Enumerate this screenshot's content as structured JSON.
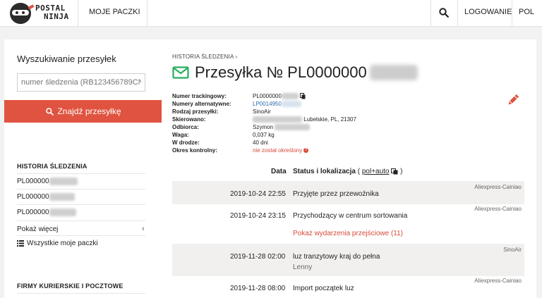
{
  "header": {
    "logo_line1": "POSTAL",
    "logo_line2": "NINJA",
    "nav_my_packages": "MOJE PACZKI",
    "nav_login": "LOGOWANIE",
    "nav_language": "POL",
    "icons": {
      "search": "search-icon",
      "logo": "ninja-logo"
    }
  },
  "sidebar": {
    "search_title": "Wyszukiwanie przesyłek",
    "search_placeholder": "numer śledzenia (RB123456789CN)",
    "search_button": "Znajdź przesyłkę",
    "history_title": "HISTORIA ŚLEDZENIA",
    "history_items": [
      {
        "label": "PL000000"
      },
      {
        "label": "PL000000"
      },
      {
        "label": "PL000000"
      }
    ],
    "show_more": "Pokaż więcej",
    "all_packages": "Wszystkie moje paczki",
    "carriers_title": "FIRMY KURIERSKIE I POCZTOWE"
  },
  "main": {
    "breadcrumb": "HISTORIA ŚLEDZENIA",
    "breadcrumb_sep": "›",
    "title": "Przesyłka № PL0000000",
    "info": {
      "tracking_label": "Numer trackingowy:",
      "tracking_value": "PL0000000",
      "alt_label": "Numery alternatywne:",
      "alt_value": "LP0014950",
      "type_label": "Rodzaj przesyłki:",
      "type_value": "SinoAir",
      "directed_label": "Skierowano:",
      "directed_value": "Lubelskie, PL, 21307",
      "recipient_label": "Odbiorca:",
      "recipient_value": "Szymon",
      "weight_label": "Waga:",
      "weight_value": "0,037 kg",
      "transit_label": "W drodze:",
      "transit_value": "40 dni",
      "control_label": "Okres kontrolny:",
      "control_value": "nie został określony"
    },
    "events_header": {
      "date": "Data",
      "status": "Status i lokalizacja",
      "lang_open": "(",
      "lang": "pol+auto",
      "lang_close": ")"
    },
    "events": [
      {
        "date": "2019-10-24 22:55",
        "desc": "Przyjęte przez przewoźnika",
        "carrier": "Aliexpress-Cainiao",
        "sub": ""
      },
      {
        "date": "2019-10-24 23:15",
        "desc": "Przychodzący w centrum sortowania",
        "carrier": "Aliexpress-Cainiao",
        "sub": ""
      },
      {
        "date": "2019-11-28 02:00",
        "desc": "luz tranzytowy kraj do pełna",
        "carrier": "SinoAir",
        "sub": "Lenny"
      },
      {
        "date": "2019-11-28 08:00",
        "desc": "Import początek luz",
        "carrier": "Aliexpress-Cainiao",
        "sub": ""
      }
    ],
    "show_transit_events": "Pokaż wydarzenia przejściowe (11)"
  },
  "colors": {
    "accent": "#e05340",
    "green": "#27ae60",
    "link": "#2b6aa8"
  }
}
